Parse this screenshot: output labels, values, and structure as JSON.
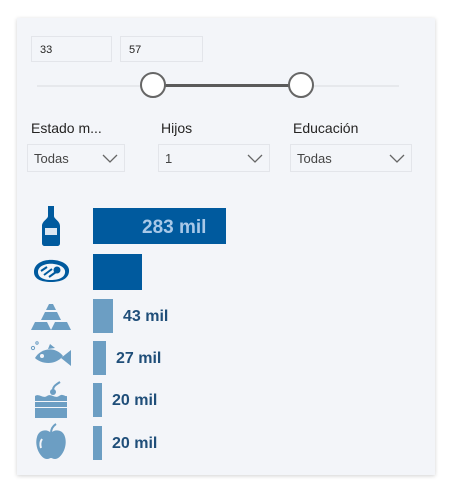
{
  "range": {
    "min_value": "33",
    "max_value": "57",
    "min_fraction": 0.32,
    "max_fraction": 0.73
  },
  "filters": [
    {
      "label": "Estado m...",
      "selected": "Todas"
    },
    {
      "label": "Hijos",
      "selected": "1"
    },
    {
      "label": "Educación",
      "selected": "Todas"
    }
  ],
  "chart_data": {
    "type": "bar",
    "categories": [
      "bottle-icon",
      "meat-icon",
      "gold-icon",
      "fish-icon",
      "sweets-icon",
      "fruit-icon"
    ],
    "values": [
      283,
      105,
      43,
      27,
      20,
      20
    ],
    "labels": [
      "283 mil",
      "",
      "43 mil",
      "27 mil",
      "20 mil",
      "20 mil"
    ],
    "unit": "mil",
    "colors": {
      "dark": "#005a9e",
      "light": "#6c9ec3",
      "label_on_bar": "#a8c8e8",
      "label": "#1f4e79"
    },
    "highlighted": [
      true,
      true,
      false,
      false,
      false,
      false
    ]
  }
}
